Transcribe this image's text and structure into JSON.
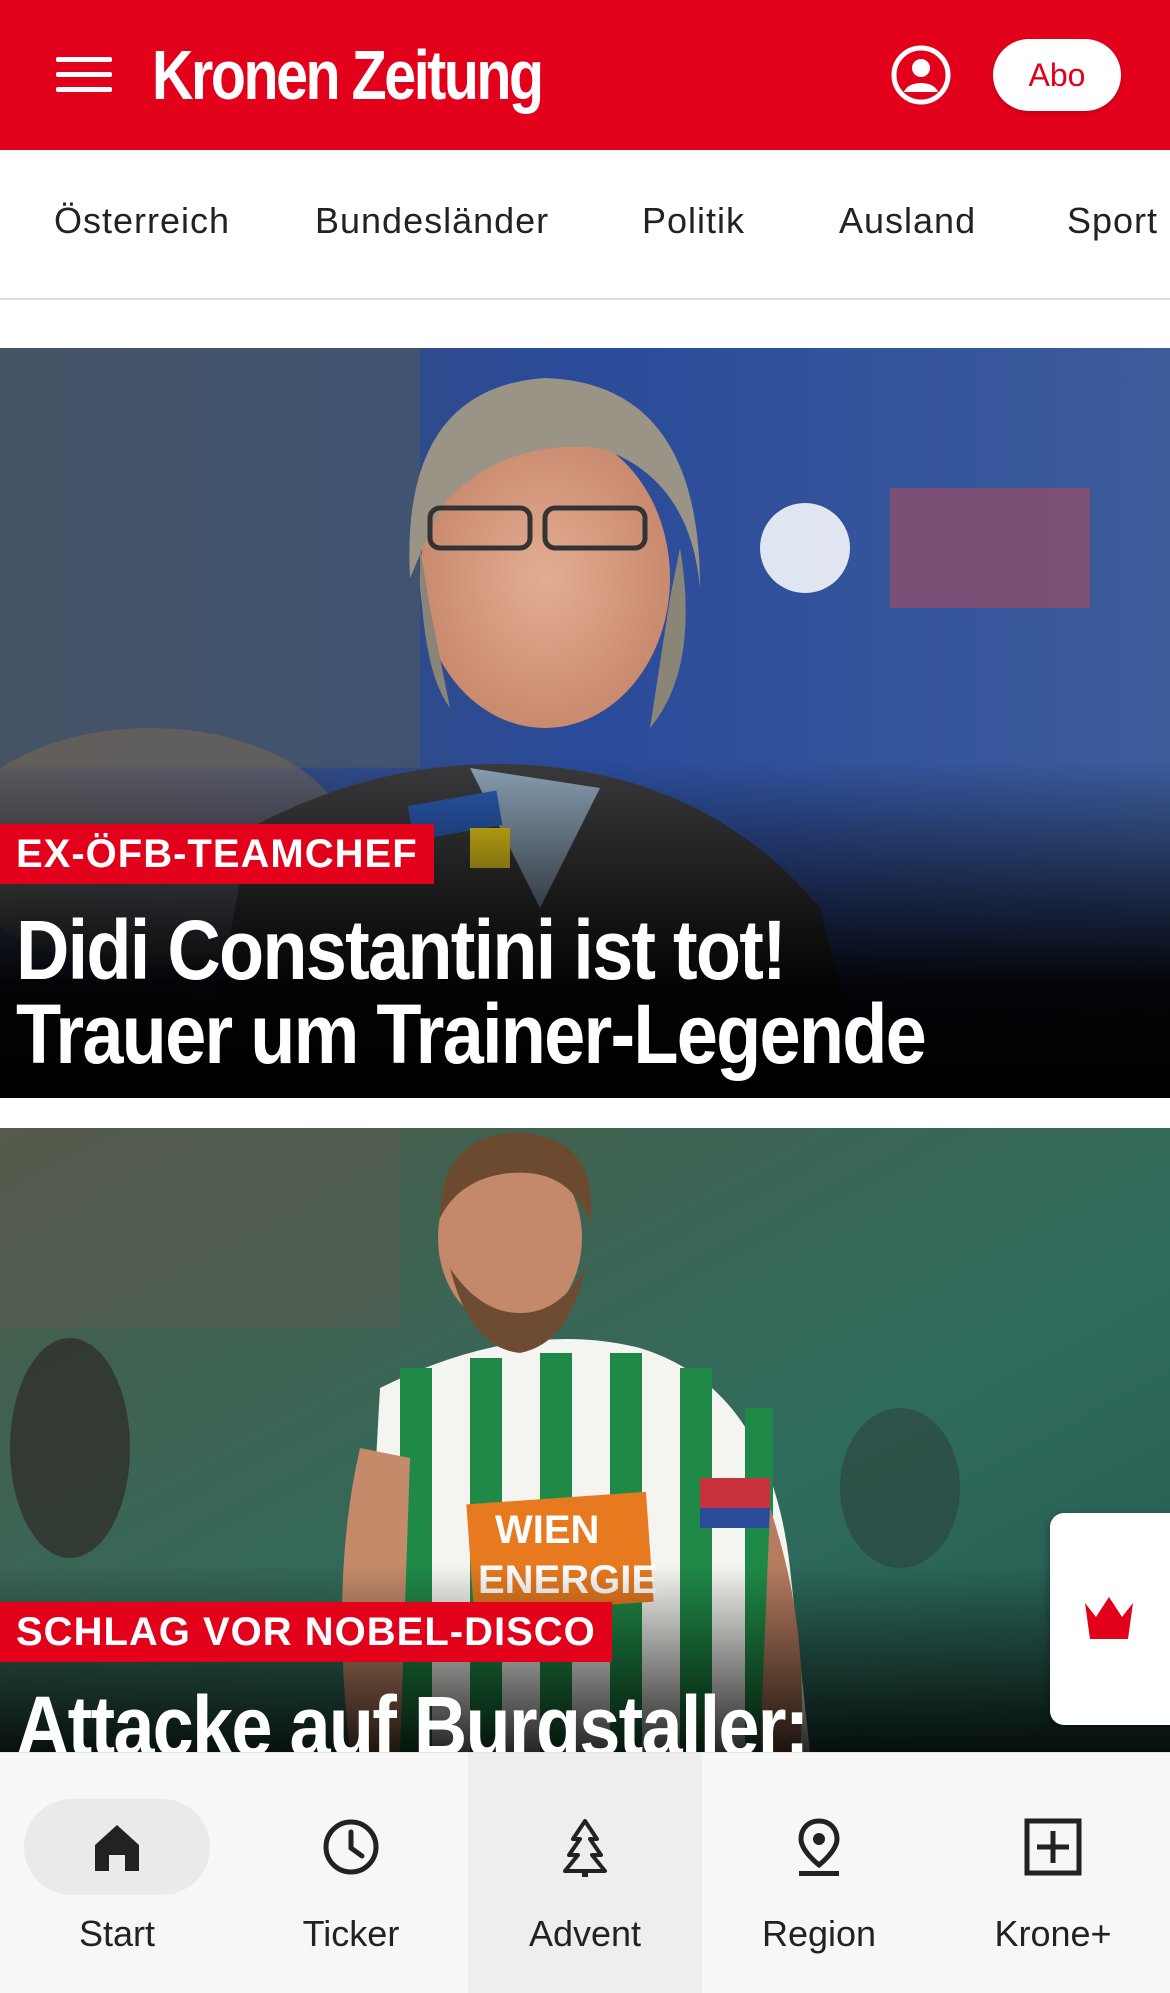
{
  "header": {
    "logo_text": "Kronen Zeitung",
    "abo_label": "Abo",
    "brand_color": "#e2001a",
    "icons": [
      "menu-icon",
      "user-account-icon"
    ]
  },
  "categories": [
    {
      "label": "Österreich"
    },
    {
      "label": "Bundesländer"
    },
    {
      "label": "Politik"
    },
    {
      "label": "Ausland"
    },
    {
      "label": "Sport"
    }
  ],
  "articles": [
    {
      "kicker": "EX-ÖFB-TEAMCHEF",
      "headline_line1": "Didi Constantini ist tot!",
      "headline_line2": "Trauer um Trainer-Legende",
      "image": "coach-portrait-photo"
    },
    {
      "kicker": "SCHLAG VOR NOBEL-DISCO",
      "headline_line1": "Attacke auf Burgstaller:",
      "image": "football-player-photo"
    }
  ],
  "floating_tab": {
    "icon": "crown-icon"
  },
  "bottom_nav": [
    {
      "label": "Start",
      "icon": "home-icon",
      "active": true
    },
    {
      "label": "Ticker",
      "icon": "clock-icon",
      "active": false
    },
    {
      "label": "Advent",
      "icon": "tree-icon",
      "active": false
    },
    {
      "label": "Region",
      "icon": "location-pin-icon",
      "active": false
    },
    {
      "label": "Krone+",
      "icon": "plus-box-icon",
      "active": false
    }
  ]
}
